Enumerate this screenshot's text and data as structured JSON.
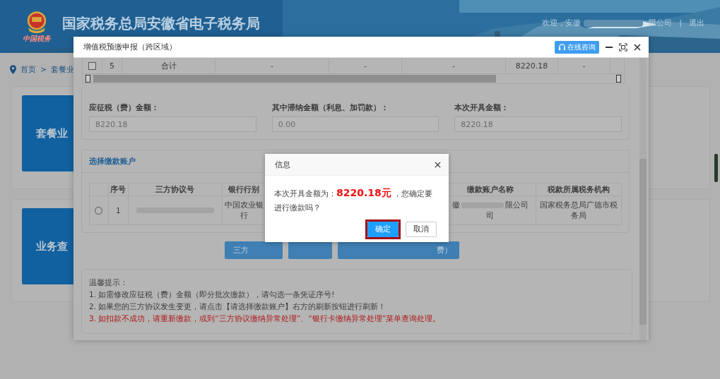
{
  "header": {
    "logo_text": "中国税务",
    "title": "国家税务总局安徽省电子税务局",
    "welcome": "欢迎，安徽",
    "company_tail": "限公司",
    "separator": "|",
    "logout": "退出"
  },
  "breadcrumb": {
    "home": "首页",
    "separator": ">",
    "current": "套餐业"
  },
  "tiles": [
    {
      "label": "套餐业"
    },
    {
      "label": "业务查"
    }
  ],
  "modal": {
    "title": "增值税预缴申报（跨区域）",
    "consult_button": "在线咨询",
    "summary_row": {
      "checked": false,
      "cells": [
        "5",
        "合计",
        "-",
        "-",
        "-",
        "8220.18",
        "-"
      ]
    },
    "fields": [
      {
        "label": "应征税（费）金额：",
        "value": "8220.18"
      },
      {
        "label": "其中滞纳金额（利息、加罚款）：",
        "value": "0.00"
      },
      {
        "label": "本次开具金额：",
        "value": "8220.18"
      }
    ],
    "account_section": {
      "title": "选择缴款账户",
      "columns": [
        "序号",
        "三方协议号",
        "银行行别",
        null,
        "缴款账户名称",
        "税款所属税务机构"
      ],
      "rows": [
        {
          "selected": false,
          "index": "1",
          "bank": "中国农业银行",
          "account_name_start": "徽",
          "account_name_end": "限公司",
          "account_name_wrap": "司",
          "tax_office": "国家税务总局广德市税务局"
        }
      ]
    },
    "buttons": [
      {
        "kind": "text",
        "label": "三方"
      },
      {
        "kind": "blank"
      },
      {
        "kind": "text",
        "label": "费）"
      }
    ],
    "tips": [
      {
        "text": "温馨提示：",
        "warning": false
      },
      {
        "text": "1. 如需修改应征税（费）金额（即分批次缴款），请勾选一条凭证序号!",
        "warning": false
      },
      {
        "text": "2. 如果您的三方协议发生变更，请点击【请选择缴款账户】右方的刷新按钮进行刷新！",
        "warning": false
      },
      {
        "text": "3. 如扣款不成功，请重新缴款，或到“三方协议缴纳异常处理”、“银行卡缴纳异常处理”菜单查询处理。",
        "warning": true
      }
    ]
  },
  "dialog": {
    "title": "信息",
    "message": "本次开具金额为：**8220.18元** ，您确定要进行缴款吗？",
    "buttons": [
      {
        "label": "确定",
        "kind": "primary",
        "outlined": true
      },
      {
        "label": "取消",
        "kind": "default",
        "outlined": false
      }
    ]
  }
}
